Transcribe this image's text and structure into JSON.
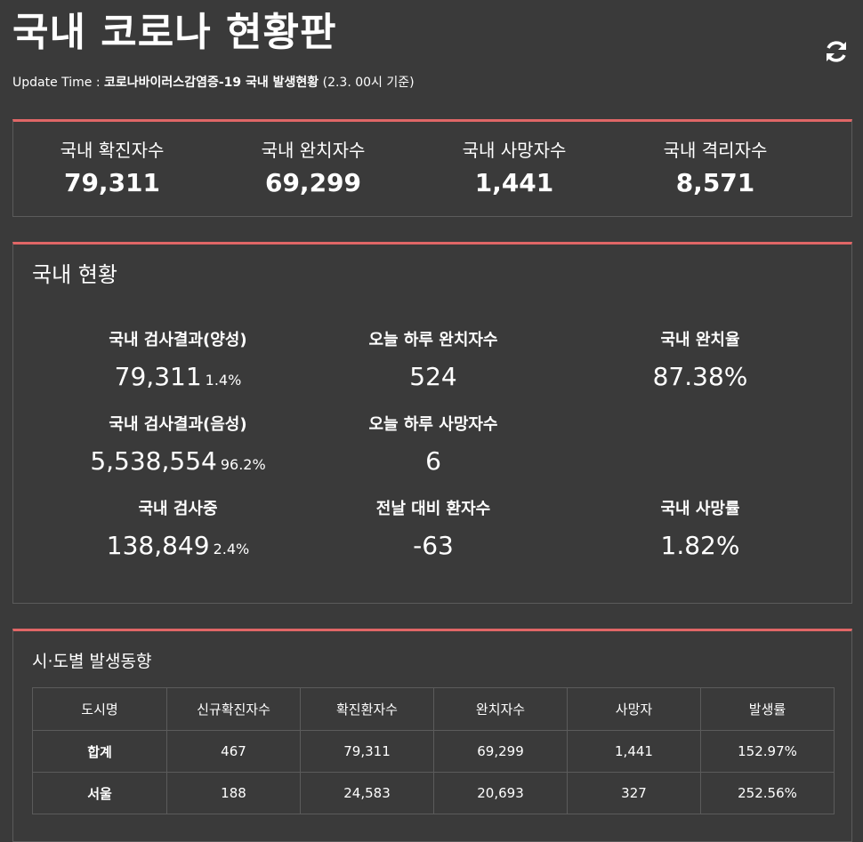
{
  "header": {
    "title": "국내 코로나 현황판",
    "update_label": "Update Time : ",
    "update_source": "코로나바이러스감염증-19 국내 발생현황",
    "update_date": "(2.3. 00시 기준)",
    "refresh_icon": "refresh-icon"
  },
  "summary": [
    {
      "label": "국내 확진자수",
      "value": "79,311"
    },
    {
      "label": "국내 완치자수",
      "value": "69,299"
    },
    {
      "label": "국내 사망자수",
      "value": "1,441"
    },
    {
      "label": "국내 격리자수",
      "value": "8,571"
    }
  ],
  "status": {
    "title": "국내 현황",
    "positive": {
      "label": "국내 검사결과(양성)",
      "value": "79,311",
      "pct": "1.4%"
    },
    "negative": {
      "label": "국내 검사결과(음성)",
      "value": "5,538,554",
      "pct": "96.2%"
    },
    "testing": {
      "label": "국내 검사중",
      "value": "138,849",
      "pct": "2.4%"
    },
    "today_recovered": {
      "label": "오늘 하루 완치자수",
      "value": "524"
    },
    "today_deaths": {
      "label": "오늘 하루 사망자수",
      "value": "6"
    },
    "patient_change": {
      "label": "전날 대비 환자수",
      "value": "-63"
    },
    "recovery_rate": {
      "label": "국내 완치율",
      "value": "87.38%"
    },
    "death_rate": {
      "label": "국내 사망률",
      "value": "1.82%"
    }
  },
  "region": {
    "title": "시·도별 발생동향",
    "columns": [
      "도시명",
      "신규확진자수",
      "확진환자수",
      "완치자수",
      "사망자",
      "발생률"
    ],
    "rows": [
      [
        "합계",
        "467",
        "79,311",
        "69,299",
        "1,441",
        "152.97%"
      ],
      [
        "서울",
        "188",
        "24,583",
        "20,693",
        "327",
        "252.56%"
      ]
    ]
  },
  "colors": {
    "background": "#3a3a3a",
    "accent": "#e06666",
    "border": "#5b5b5b",
    "text": "#ffffff"
  }
}
